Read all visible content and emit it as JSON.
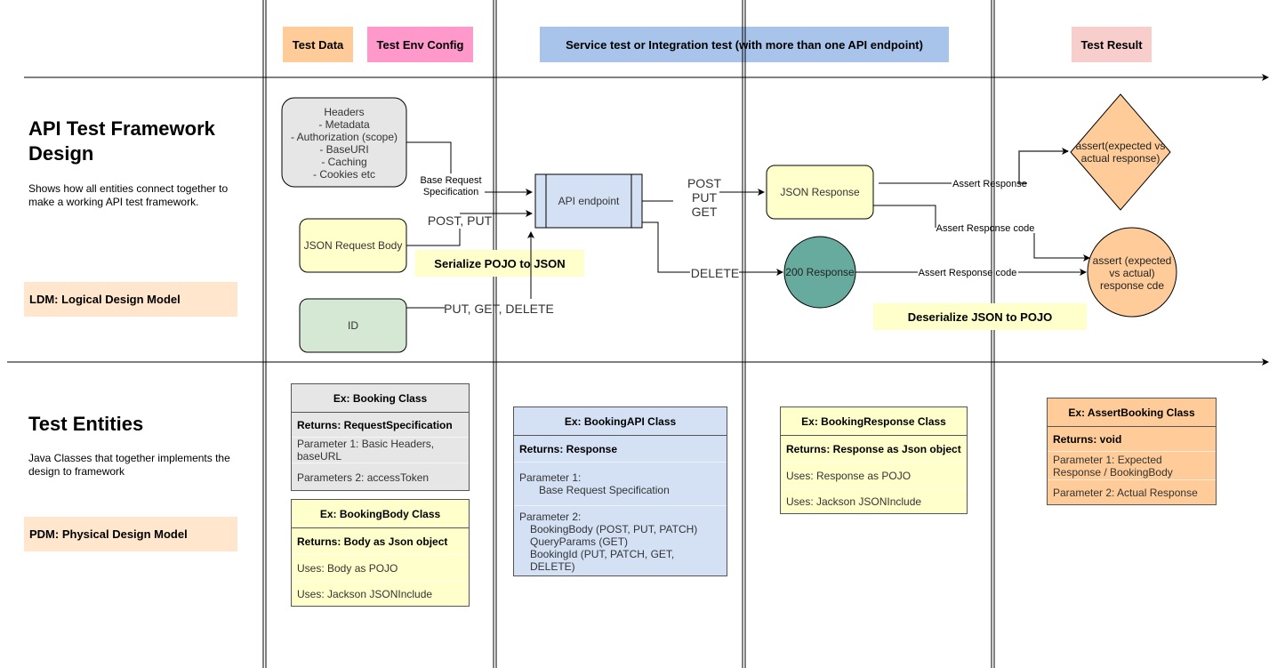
{
  "columns": {
    "test_data": "Test Data",
    "test_env_config": "Test Env Config",
    "service_test": "Service test or Integration test (with more than one API endpoint)",
    "test_result": "Test Result"
  },
  "colors": {
    "test_data": "#FFCC99",
    "test_env_config": "#FF99CC",
    "service_test": "#A9C4EB",
    "test_result": "#F8CECC",
    "yellow": "#FFFFCC",
    "gray": "#E6E6E6",
    "blue": "#D4E1F5",
    "green": "#D5E8D4",
    "teal": "#67AB9F",
    "orange": "#FFCC99",
    "model": "#FFE6CC"
  },
  "ldm": {
    "title": "API Test Framework Design",
    "description": "Shows how all entities connect together to make a working API test framework.",
    "model_label": "LDM: Logical Design Model",
    "headers_box": [
      "Headers",
      "- Metadata",
      "- Authorization (scope)",
      "- BaseURI",
      "- Caching",
      "- Cookies etc"
    ],
    "json_request_body": "JSON Request Body",
    "id_box": "ID",
    "api_endpoint": "API endpoint",
    "serialize_note": "Serialize POJO to JSON",
    "deserialize_note": "Deserialize JSON to POJO",
    "json_response": "JSON Response",
    "response_200": "200 Response",
    "assert_response_diamond": [
      "assert(expected vs",
      "actual response)"
    ],
    "assert_code_circle": [
      "assert (expected",
      "vs actual)",
      "response cde"
    ],
    "edges": {
      "base_request_spec": [
        "Base Request",
        "Specification"
      ],
      "post_put": "POST, PUT",
      "put_get_delete": "PUT, GET, DELETE",
      "post_put_get": [
        "POST",
        "PUT",
        "GET"
      ],
      "delete": "DELETE",
      "assert_response": "Assert Response",
      "assert_response_code_1": "Assert Response code",
      "assert_response_code_2": "Assert Response code"
    }
  },
  "pdm": {
    "title": "Test Entities",
    "description": "Java Classes that together implements the design to framework",
    "model_label": "PDM: Physical Design Model",
    "classes": {
      "booking": {
        "header": "Ex: Booking Class",
        "rows": [
          "Returns: RequestSpecification",
          "Parameter 1: Basic Headers, baseURL",
          "Parameters 2: accessToken"
        ]
      },
      "booking_body": {
        "header": "Ex: BookingBody Class",
        "rows": [
          "Returns: Body as Json object",
          "Uses: Body as POJO",
          "Uses: Jackson JSONInclude"
        ]
      },
      "booking_api": {
        "header": "Ex: BookingAPI Class",
        "rows": [
          "Returns: Response",
          "Parameter 1:",
          "Base Request Specification",
          "Parameter 2:",
          "BookingBody (POST, PUT, PATCH)",
          "QueryParams (GET)",
          "BookingId (PUT, PATCH, GET, DELETE)"
        ]
      },
      "booking_response": {
        "header": "Ex: BookingResponse Class",
        "rows": [
          "Returns: Response as Json object",
          "Uses: Response as POJO",
          "Uses: Jackson JSONInclude"
        ]
      },
      "assert_booking": {
        "header": "Ex: AssertBooking Class",
        "rows": [
          "Returns: void",
          "Parameter 1: Expected Response / BookingBody",
          "Parameter 2: Actual Response"
        ]
      }
    }
  }
}
